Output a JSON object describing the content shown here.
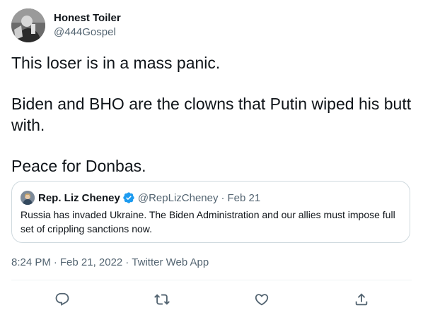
{
  "author": {
    "display_name": "Honest Toiler",
    "handle": "@444Gospel",
    "avatar_icon": "profile-photo"
  },
  "tweet": {
    "lines": [
      "This loser is in a mass panic.",
      "Biden and BHO are the clowns that Putin wiped his butt with.",
      "Peace for Donbas."
    ]
  },
  "quoted_tweet": {
    "display_name": "Rep. Liz Cheney",
    "verified_icon": "verified-badge-icon",
    "handle": "@RepLizCheney",
    "separator": "·",
    "date": "Feb 21",
    "text": "Russia has invaded Ukraine. The Biden Administration and our allies must impose full set of crippling sanctions now."
  },
  "meta": {
    "time": "8:24 PM",
    "separator": "·",
    "date": "Feb 21, 2022",
    "source": "Twitter Web App"
  },
  "actions": {
    "reply_icon": "reply-icon",
    "retweet_icon": "retweet-icon",
    "like_icon": "like-icon",
    "share_icon": "share-icon"
  },
  "colors": {
    "text_primary": "#0f1419",
    "text_secondary": "#536471",
    "border": "#cfd9de",
    "verified_blue": "#1d9bf0"
  }
}
